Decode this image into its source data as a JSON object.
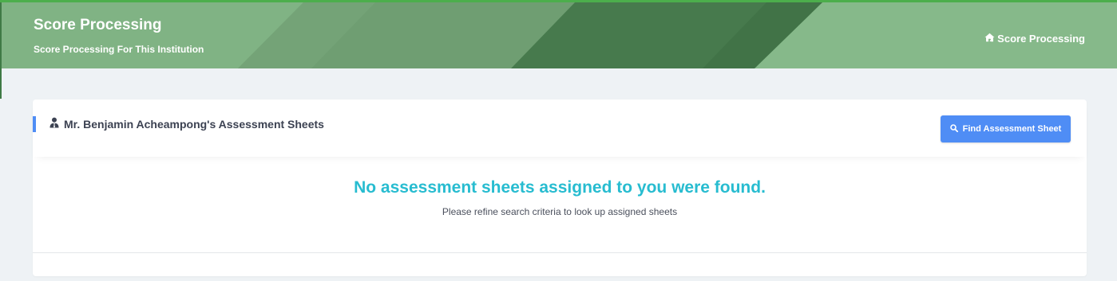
{
  "header": {
    "title": "Score Processing",
    "subtitle": "Score Processing For This Institution",
    "colors": {
      "accent": "#4cae4c",
      "banner_base": "#7aae7e",
      "banner_dark": "#477a4d"
    }
  },
  "breadcrumb": {
    "home_icon": "home-icon",
    "separator_icon": "chevron-right-icon",
    "current": "Score Processing"
  },
  "card": {
    "icon": "user-tie-icon",
    "title": "Mr. Benjamin Acheampong's Assessment Sheets",
    "find_button": {
      "icon": "search-icon",
      "label": "Find Assessment Sheet",
      "color": "#4f8df5"
    },
    "empty_state": {
      "title": "No assessment sheets assigned to you were found.",
      "subtitle": "Please refine search criteria to look up assigned sheets",
      "title_color": "#27bcd0"
    }
  }
}
